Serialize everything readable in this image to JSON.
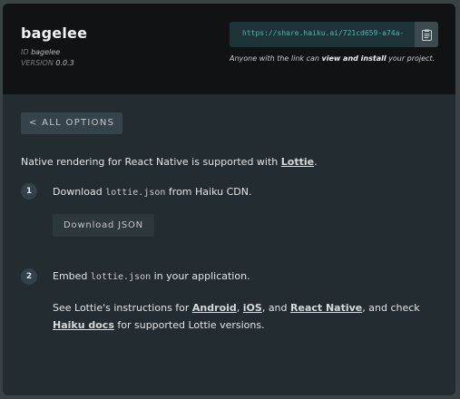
{
  "header": {
    "project_name": "bagelee",
    "id_label": "ID",
    "id_value": "bagelee",
    "version_label": "VERSION",
    "version_value": "0.0.3",
    "share_url": "https://share.haiku.ai/721cd659-a74a-",
    "copy_icon": "clipboard-icon",
    "share_note_prefix": "Anyone with the link can ",
    "share_note_bold": "view and install",
    "share_note_suffix": " your project."
  },
  "back_button_label": "< ALL OPTIONS",
  "intro": {
    "prefix": "Native rendering for React Native is supported with ",
    "link": "Lottie",
    "suffix": "."
  },
  "steps": [
    {
      "number": "1",
      "prefix": "Download ",
      "code": "lottie.json",
      "suffix": " from Haiku CDN.",
      "button_label": "Download JSON"
    },
    {
      "number": "2",
      "prefix": "Embed ",
      "code": "lottie.json",
      "suffix": " in your application."
    }
  ],
  "instructions": {
    "t1": "See Lottie's instructions for ",
    "android": "Android",
    "t2": ", ",
    "ios": "iOS",
    "t3": ", and ",
    "react_native": "React Native",
    "t4": ", and check",
    "haiku_docs": "Haiku docs",
    "t5": " for supported Lottie versions."
  }
}
